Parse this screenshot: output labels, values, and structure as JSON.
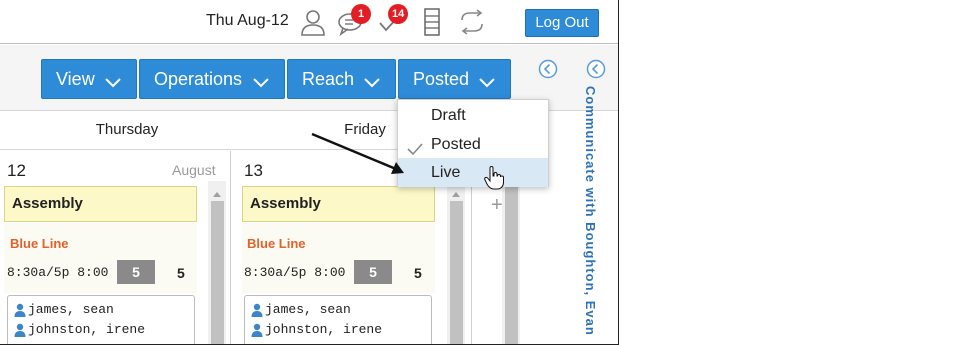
{
  "topbar": {
    "date": "Thu Aug-12",
    "messages_badge": "1",
    "tasks_badge": "14",
    "logout_label": "Log Out"
  },
  "toolbar": {
    "buttons": [
      {
        "label": "View"
      },
      {
        "label": "Operations"
      },
      {
        "label": "Reach"
      },
      {
        "label": "Posted"
      }
    ]
  },
  "dropdown": {
    "items": [
      {
        "label": "Draft",
        "checked": false,
        "highlighted": false
      },
      {
        "label": "Posted",
        "checked": true,
        "highlighted": false
      },
      {
        "label": "Live",
        "checked": false,
        "highlighted": true
      }
    ]
  },
  "days": [
    {
      "header": "Thursday",
      "number": "12",
      "month": "August",
      "event": "Assembly",
      "line": "Blue Line",
      "time": "8:30a/5p 8:00",
      "count_box": "5",
      "count_plain": "5",
      "people": [
        "james, sean",
        "johnston, irene"
      ]
    },
    {
      "header": "Friday",
      "number": "13",
      "month": "",
      "event": "Assembly",
      "line": "Blue Line",
      "time": "8:30a/5p 8:00",
      "count_box": "5",
      "count_plain": "5",
      "people": [
        "james, sean",
        "johnston, irene"
      ]
    }
  ],
  "side_panel": {
    "label": "Communicate with Boughton, Evan"
  },
  "plus": "+",
  "icons": [
    "user-icon",
    "chat-icon",
    "check-icon",
    "list-icon",
    "sync-icon",
    "chevron-down-icon",
    "collapse-left-icon",
    "person-icon",
    "hand-cursor-icon"
  ],
  "colors": {
    "primary": "#2e8bd8",
    "badge": "#e21d24",
    "event_bg": "#fdf8c8",
    "line_color": "#e0622c",
    "vertical_text": "#2e73b8"
  }
}
